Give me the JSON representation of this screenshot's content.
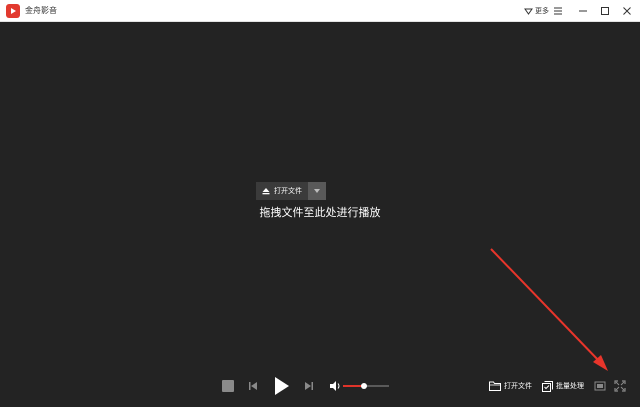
{
  "app": {
    "title": "金舟影音",
    "accent_color": "#e23a2f"
  },
  "titlebar": {
    "more_label": "更多",
    "icons": [
      "more-icon",
      "menu-icon",
      "minimize-icon",
      "maximize-icon",
      "close-icon"
    ]
  },
  "center": {
    "open_button_label": "打开文件",
    "drop_hint": "拖拽文件至此处进行播放"
  },
  "controls": {
    "volume_level": 0.45,
    "volume_color": "#e0342a",
    "open_file_label": "打开文件",
    "batch_label": "批量处理"
  },
  "annotation": {
    "color": "#e8352b",
    "target": "fullscreen-button"
  }
}
